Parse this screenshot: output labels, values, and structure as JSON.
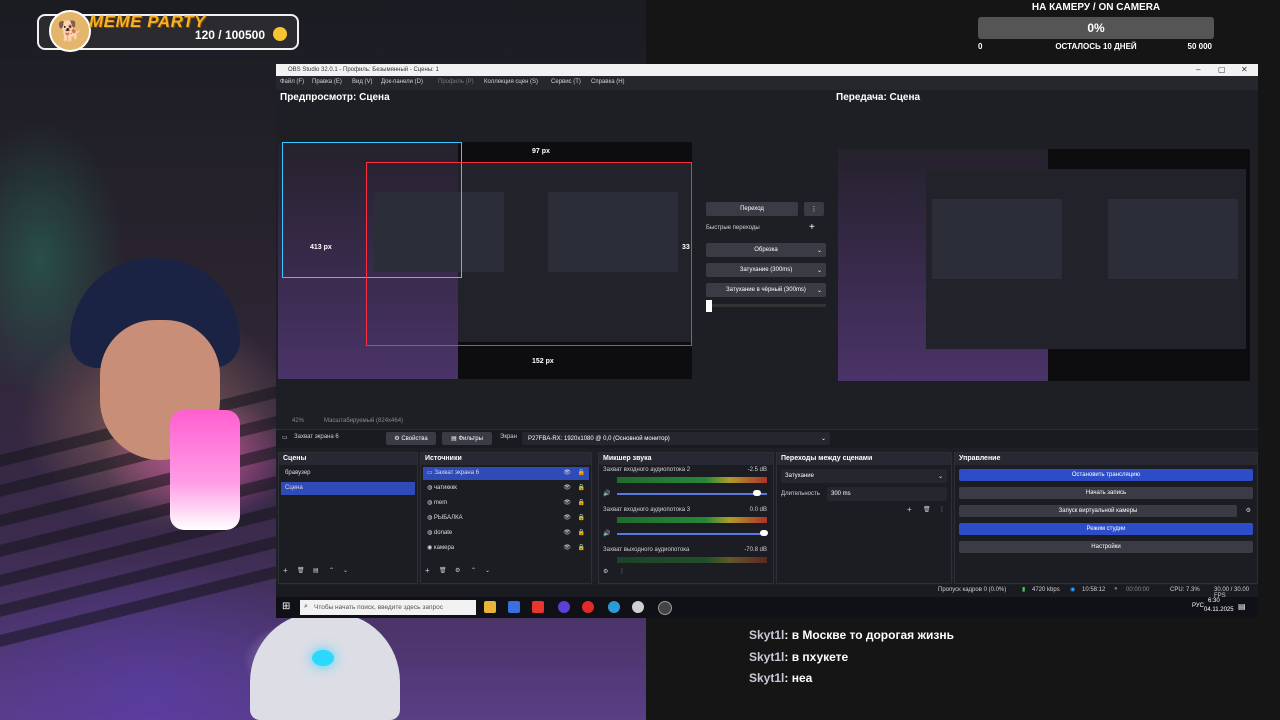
{
  "overlay": {
    "meme_party": {
      "title": "MEME PARTY",
      "count": "120 / 100500"
    },
    "camera_goal": {
      "title": "НА КАМЕРУ / ON CAMERA",
      "percent": "0%",
      "progress": 0,
      "min": "0",
      "remaining": "ОСТАЛОСЬ 10 ДНЕЙ",
      "max": "50 000"
    },
    "chat": [
      {
        "user": "Skyt1l",
        "message": ": в Москве то дорогая жизнь"
      },
      {
        "user": "Skyt1l",
        "message": ": в пхукете"
      },
      {
        "user": "Skyt1l",
        "message": ": неа"
      }
    ]
  },
  "obs": {
    "title": "OBS Studio 32.0.1 - Профиль: Безымянный - Сцены: 1",
    "window_controls": {
      "minimize": "–",
      "maximize": "▢",
      "close": "✕"
    },
    "menu": [
      "Файл (F)",
      "Правка (E)",
      "Вид (V)",
      "Док-панели (D)",
      "Профиль (P)",
      "Коллекция сцен (S)",
      "Сервис (T)",
      "Справка (H)"
    ],
    "preview_title": "Предпросмотр: Сцена",
    "program_title": "Передача: Сцена",
    "preview_labels": {
      "top_px": "97 px",
      "left_px": "413 px",
      "right_px": "33",
      "bottom_px": "152 px"
    },
    "transition": {
      "button": "Переход",
      "quick_label": "Быстрые переходы",
      "add": "+",
      "options": [
        "Обрезка",
        "Затухание (300ms)",
        "Затухание в чёрный (300ms)"
      ]
    },
    "zoom": {
      "percent": "42%",
      "label": "Масштабируемый (824x464)"
    },
    "source_toolbar": {
      "source": "Захват экрана 6",
      "properties": "Свойства",
      "filters": "Фильтры",
      "screen_label": "Экран",
      "screen_value": "P27FBA-RX: 1920x1080 @ 0,0 (Основной монитор)"
    },
    "scenes": {
      "title": "Сцены",
      "items": [
        "бравузер",
        "Сцена"
      ],
      "selected": 1
    },
    "sources": {
      "title": "Источники",
      "items": [
        "Захват экрана 6",
        "чатикккк",
        "mem",
        "РЫБАЛКА",
        "donate",
        "камера"
      ],
      "selected": 0
    },
    "mixer": {
      "title": "Микшер звука",
      "channels": [
        {
          "name": "Захват входного аудиопотока 2",
          "db": "-2.5 dB",
          "level": 0.93
        },
        {
          "name": "Захват входного аудиопотока 3",
          "db": "0.0 dB",
          "level": 0.98
        },
        {
          "name": "Захват выходного аудиопотока",
          "db": "-70.8 dB",
          "level": 0.0
        }
      ],
      "scale": [
        "-60",
        "-55",
        "-50",
        "-45",
        "-40",
        "-35",
        "-30",
        "-25",
        "-20",
        "-15",
        "-10",
        "-5",
        "0"
      ]
    },
    "scene_transitions": {
      "title": "Переходы между сценами",
      "type": "Затухание",
      "duration_label": "Длительность",
      "duration": "300 ms"
    },
    "controls": {
      "title": "Управление",
      "buttons": [
        "Остановить трансляцию",
        "Начать запись",
        "Запуск виртуальной камеры",
        "Режим студии",
        "Настройки"
      ]
    },
    "status": {
      "dropped": "Пропуск кадров 0 (0.0%)",
      "bitrate": "4720 kbps",
      "stream_time": "10:58:12",
      "rec_time": "00:00:00",
      "cpu": "CPU: 7.3%",
      "fps": "30.00 / 30.00 FPS"
    }
  },
  "taskbar": {
    "search_placeholder": "Чтобы начать поиск, введите здесь запрос",
    "language": "РУС",
    "time": "6:30",
    "date": "04.11.2025"
  },
  "colors": {
    "accent": "#2d4cc8",
    "record_red": "#ff2d3d",
    "selection_cyan": "#37c7ff"
  }
}
